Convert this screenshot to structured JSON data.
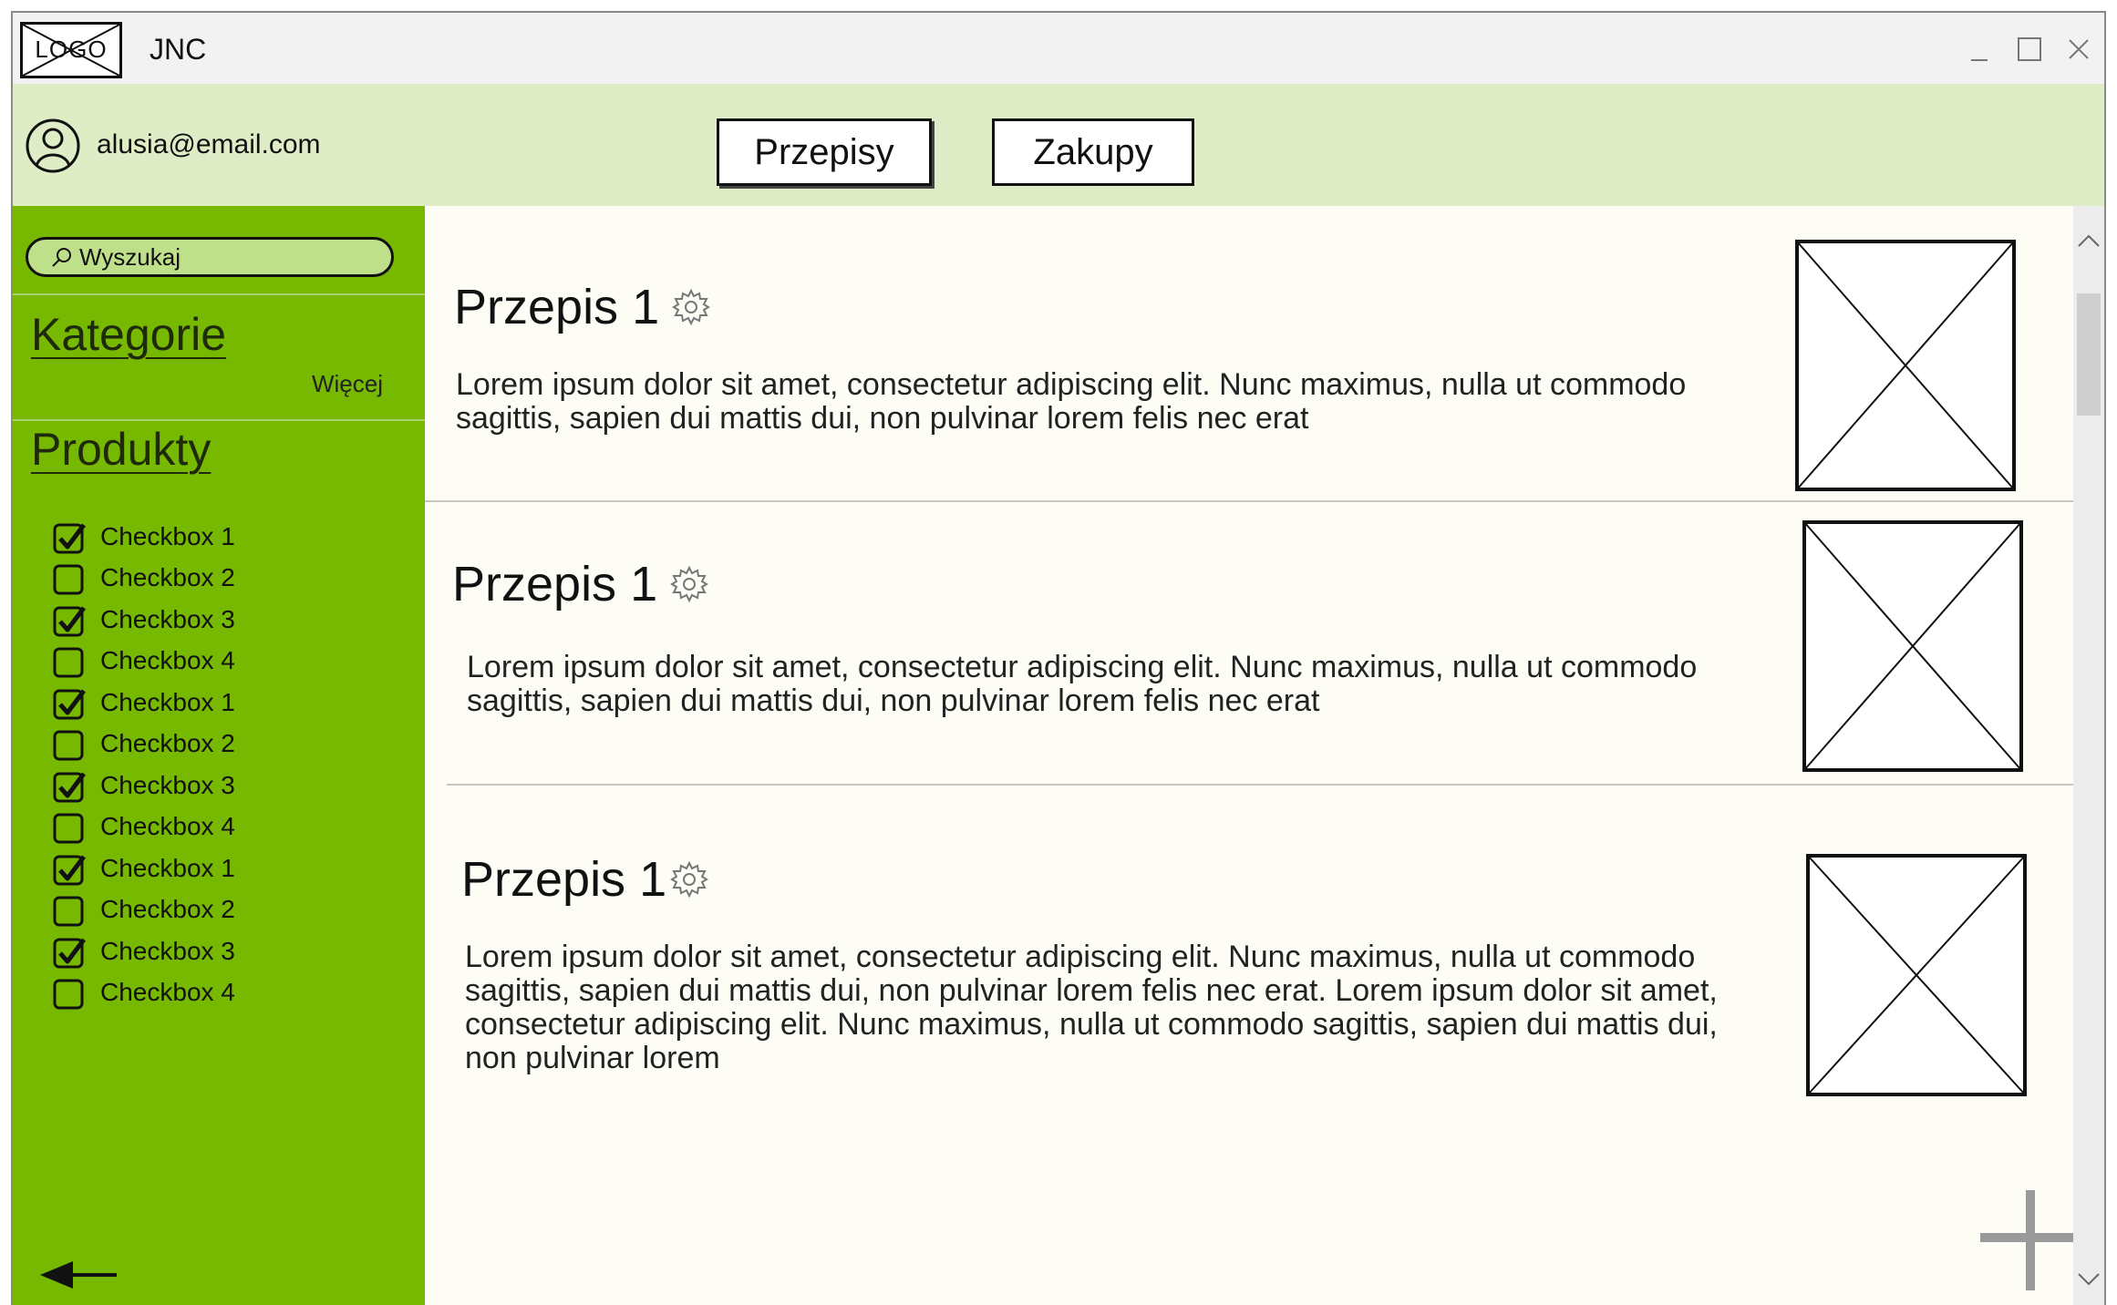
{
  "window": {
    "logo_text": "LOGO",
    "title": "JNC",
    "controls": {
      "minimize": "minimize-icon",
      "maximize": "maximize-icon",
      "close": "close-icon"
    }
  },
  "header": {
    "user_email": "alusia@email.com",
    "tabs": [
      {
        "label": "Przepisy",
        "active": true
      },
      {
        "label": "Zakupy",
        "active": false
      }
    ]
  },
  "sidebar": {
    "search_placeholder": "Wyszukaj",
    "categories_title": "Kategorie",
    "more_label": "Więcej",
    "products_title": "Produkty",
    "checkboxes": [
      {
        "label": "Checkbox 1",
        "checked": true
      },
      {
        "label": "Checkbox 2",
        "checked": false
      },
      {
        "label": "Checkbox 3",
        "checked": true
      },
      {
        "label": "Checkbox 4",
        "checked": false
      },
      {
        "label": "Checkbox 1",
        "checked": true
      },
      {
        "label": "Checkbox 2",
        "checked": false
      },
      {
        "label": "Checkbox 3",
        "checked": true
      },
      {
        "label": "Checkbox 4",
        "checked": false
      },
      {
        "label": "Checkbox 1",
        "checked": true
      },
      {
        "label": "Checkbox 2",
        "checked": false
      },
      {
        "label": "Checkbox 3",
        "checked": true
      },
      {
        "label": "Checkbox 4",
        "checked": false
      }
    ]
  },
  "recipes": [
    {
      "title": "Przepis 1",
      "text": "Lorem ipsum dolor sit amet, consectetur adipiscing elit. Nunc maximus, nulla ut commodo sagittis, sapien dui mattis dui, non pulvinar lorem felis nec erat"
    },
    {
      "title": "Przepis 1",
      "text": "Lorem ipsum dolor sit amet, consectetur adipiscing elit. Nunc maximus, nulla ut commodo sagittis, sapien dui mattis dui, non pulvinar lorem felis nec erat"
    },
    {
      "title": "Przepis 1",
      "text": "Lorem ipsum dolor sit amet, consectetur adipiscing elit. Nunc maximus, nulla ut commodo sagittis, sapien dui mattis dui, non pulvinar lorem felis nec erat. Lorem ipsum dolor sit amet, consectetur adipiscing elit. Nunc maximus, nulla ut commodo sagittis, sapien dui mattis dui, non pulvinar lorem"
    }
  ],
  "colors": {
    "sidebar": "#76b900",
    "header": "#deedc5",
    "content_bg": "#fdfdf5"
  },
  "icons": {
    "add": "plus-icon",
    "back": "back-arrow-icon",
    "settings": "gear-icon",
    "image": "image-placeholder-icon"
  }
}
